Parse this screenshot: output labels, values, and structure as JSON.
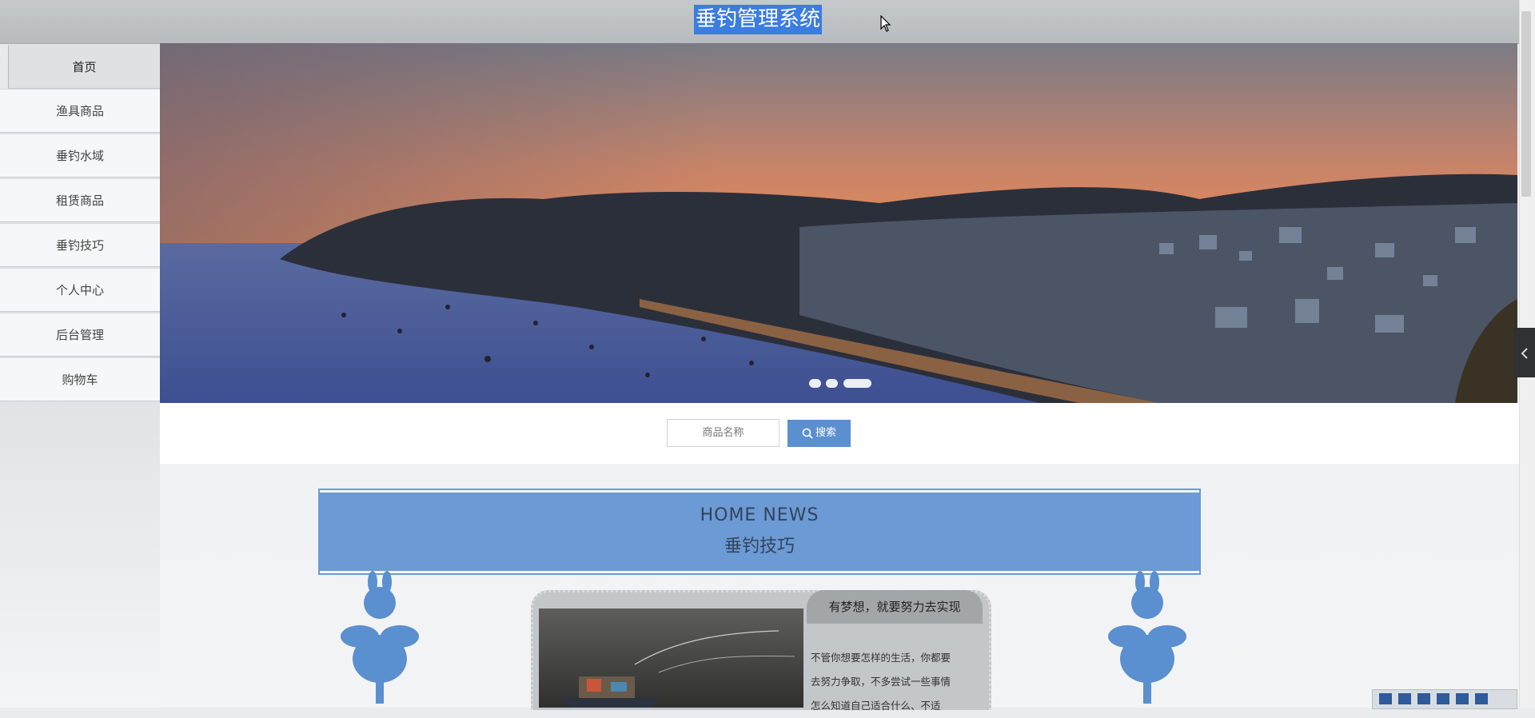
{
  "header": {
    "title": "垂钓管理系统"
  },
  "nav": {
    "items": [
      {
        "label": "首页"
      },
      {
        "label": "渔具商品"
      },
      {
        "label": "垂钓水域"
      },
      {
        "label": "租赁商品"
      },
      {
        "label": "垂钓技巧"
      },
      {
        "label": "个人中心"
      },
      {
        "label": "后台管理"
      },
      {
        "label": "购物车"
      }
    ]
  },
  "banner": {
    "slide_count": 3,
    "active_slide": 3
  },
  "search": {
    "placeholder": "商品名称",
    "button_label": "搜索"
  },
  "news": {
    "heading_en": "HOME NEWS",
    "heading_cn": "垂钓技巧"
  },
  "article": {
    "title": "有梦想，就要努力去实现",
    "excerpt_lines": [
      "不管你想要怎样的生活，你都要",
      "去努力争取，不多尝试一些事情",
      "怎么知道自己适合什么、不适"
    ]
  },
  "colors": {
    "accent": "#5a8fd0",
    "news_band": "#6b9ad5",
    "title_highlight": "#3b7de0"
  }
}
